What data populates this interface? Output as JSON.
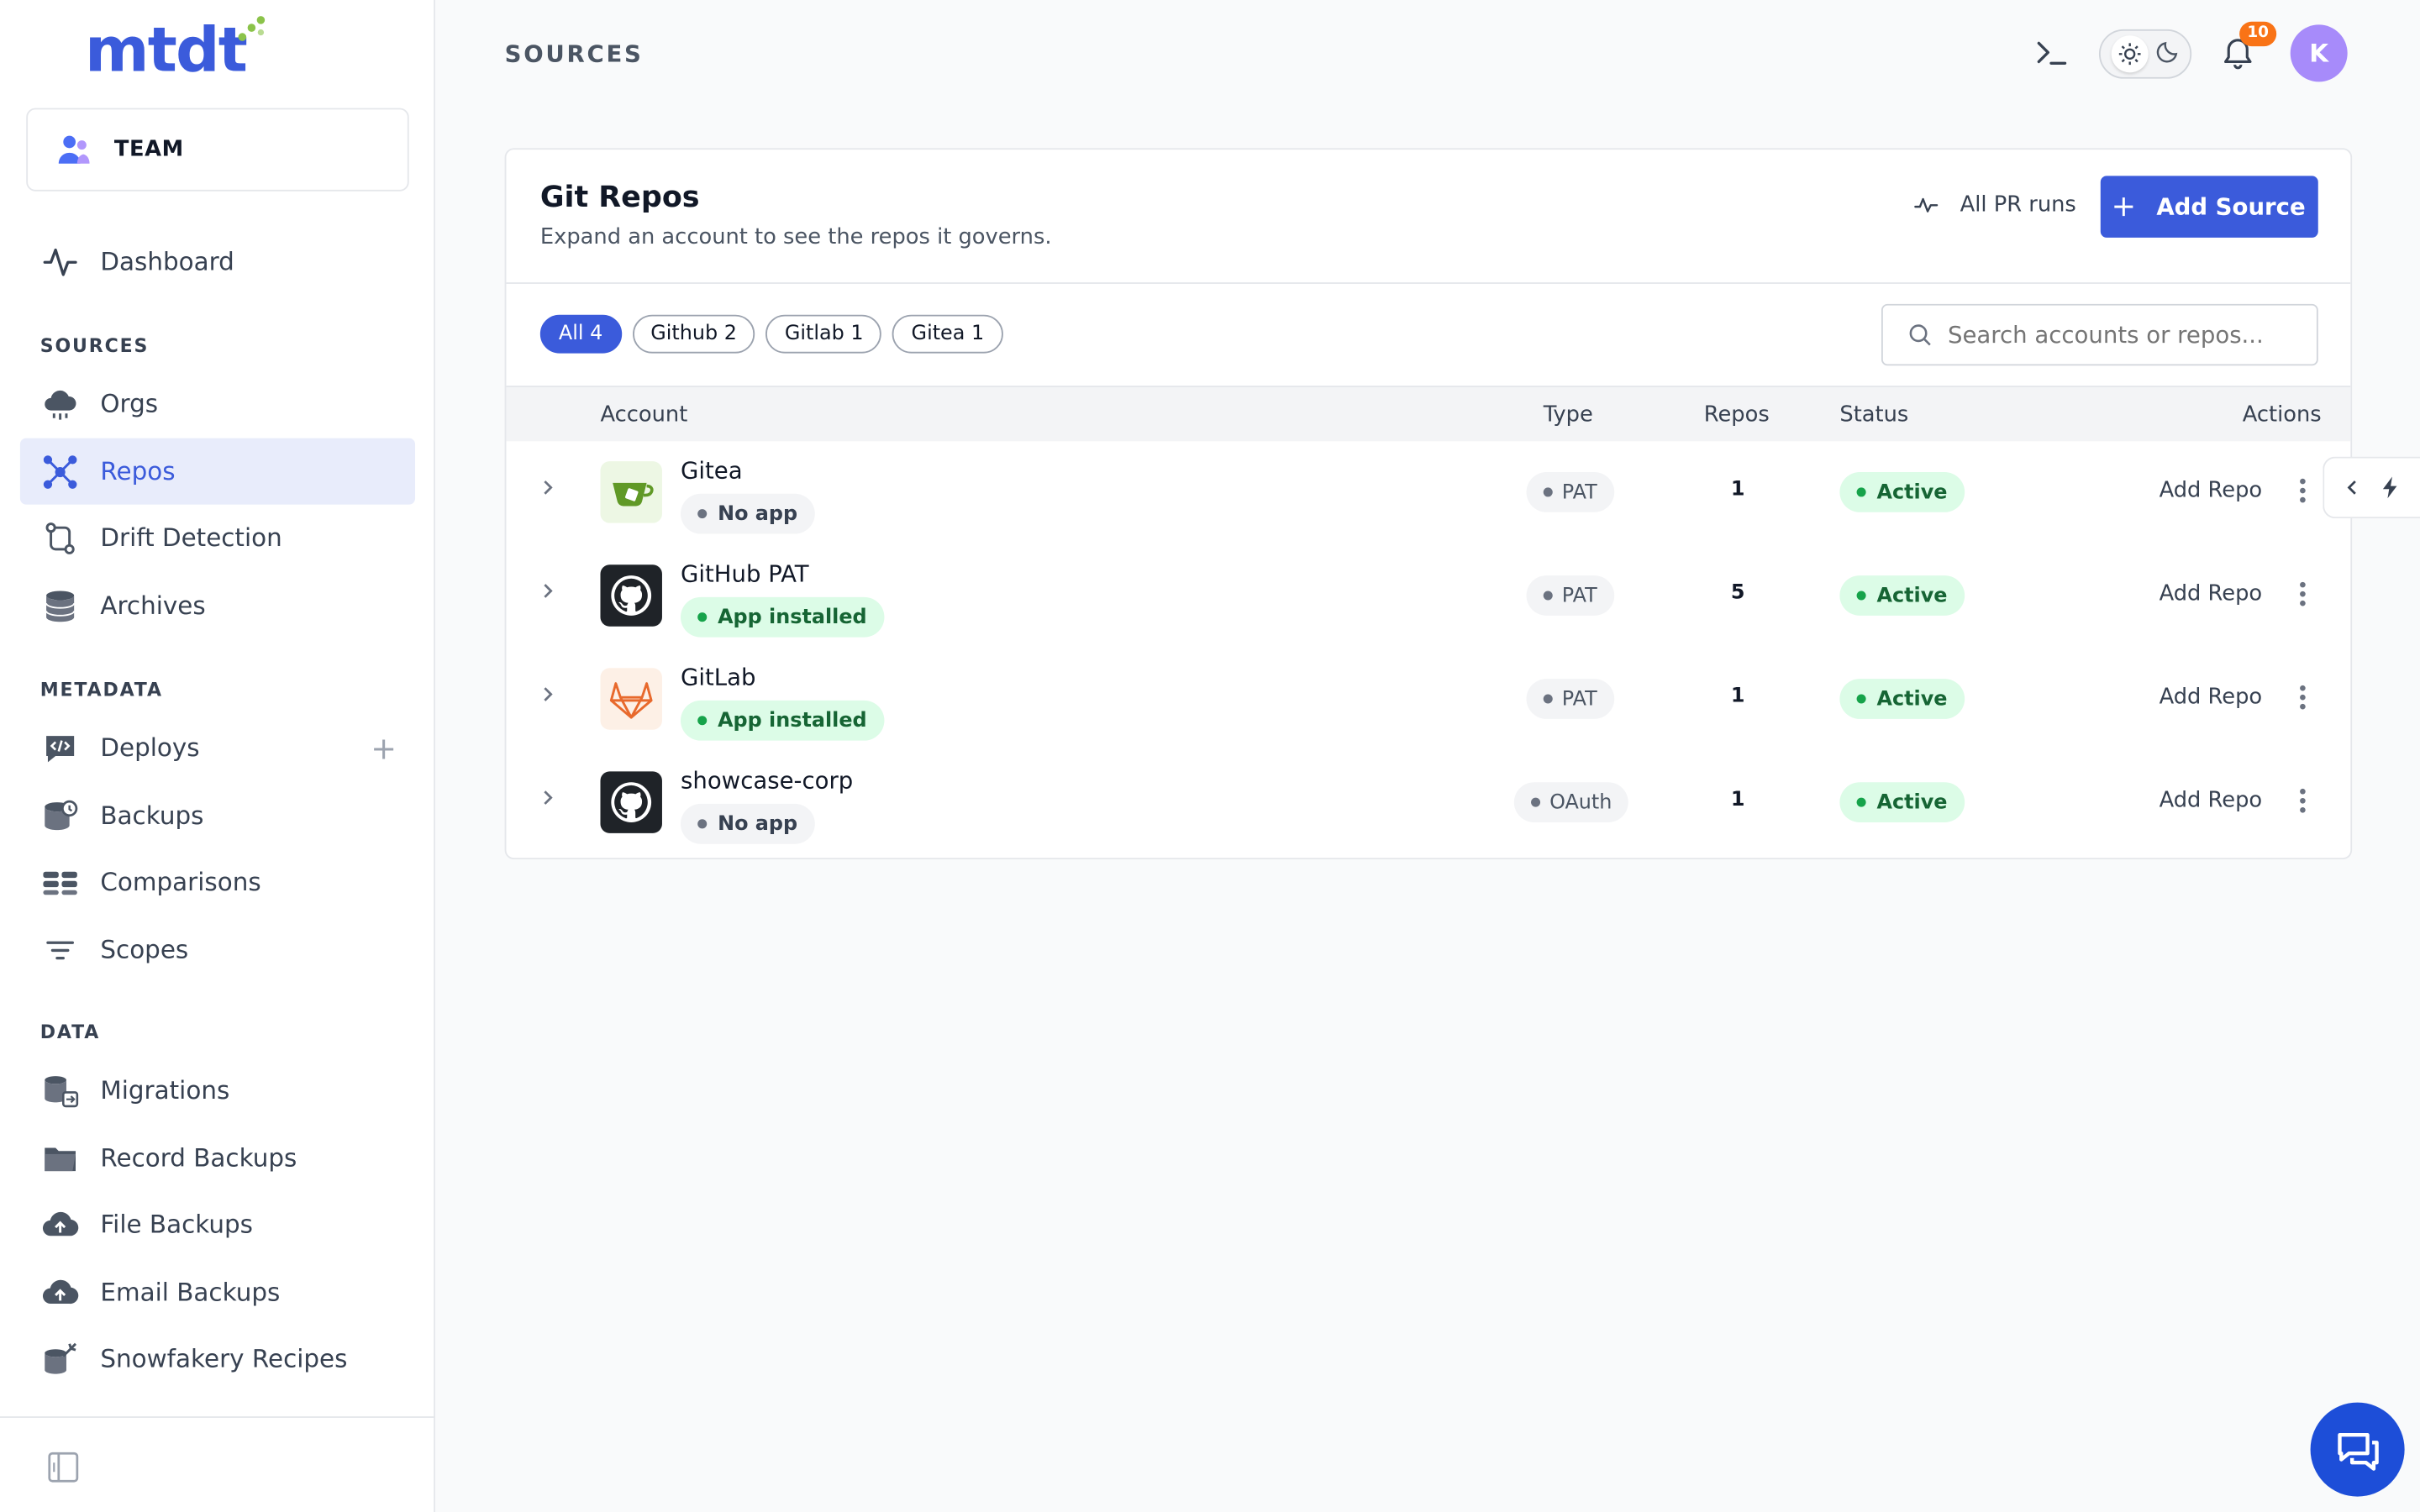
{
  "brand": {
    "logo_text": "mtdt",
    "accent": "#3b5bdb",
    "logo_dots_color": "#8bc34a"
  },
  "team": {
    "label": "TEAM"
  },
  "nav": {
    "top": [
      {
        "label": "Dashboard",
        "icon": "activity-icon"
      }
    ],
    "sections": [
      {
        "label": "SOURCES",
        "items": [
          {
            "label": "Orgs",
            "icon": "cloud-icon"
          },
          {
            "label": "Repos",
            "icon": "network-icon",
            "active": true
          },
          {
            "label": "Drift Detection",
            "icon": "git-compare-icon"
          },
          {
            "label": "Archives",
            "icon": "database-icon"
          }
        ]
      },
      {
        "label": "METADATA",
        "items": [
          {
            "label": "Deploys",
            "icon": "code-message-icon"
          },
          {
            "label": "Backups",
            "icon": "database-backup-icon"
          },
          {
            "label": "Comparisons",
            "icon": "compare-stack-icon"
          },
          {
            "label": "Scopes",
            "icon": "filter-icon"
          }
        ]
      },
      {
        "label": "DATA",
        "items": [
          {
            "label": "Migrations",
            "icon": "migration-icon"
          },
          {
            "label": "Record Backups",
            "icon": "folder-icon"
          },
          {
            "label": "File Backups",
            "icon": "cloud-upload-icon"
          },
          {
            "label": "Email Backups",
            "icon": "cloud-upload-icon"
          },
          {
            "label": "Snowfakery Recipes",
            "icon": "recipe-icon"
          }
        ]
      }
    ]
  },
  "header": {
    "title": "SOURCES",
    "notification_count": "10",
    "avatar_initial": "K"
  },
  "card": {
    "title": "Git Repos",
    "subtitle": "Expand an account to see the repos it governs.",
    "pr_runs_label": "All PR runs",
    "add_source_label": "Add Source",
    "search_placeholder": "Search accounts or repos...",
    "filters": [
      "All 4",
      "Github 2",
      "Gitlab 1",
      "Gitea 1"
    ],
    "columns": {
      "account": "Account",
      "type": "Type",
      "repos": "Repos",
      "status": "Status",
      "actions": "Actions"
    },
    "rows": [
      {
        "name": "Gitea",
        "app": "No app",
        "app_installed": false,
        "type": "PAT",
        "repos": "1",
        "status": "Active",
        "action": "Add Repo",
        "logo": "gitea-logo-icon"
      },
      {
        "name": "GitHub PAT",
        "app": "App installed",
        "app_installed": true,
        "type": "PAT",
        "repos": "5",
        "status": "Active",
        "action": "Add Repo",
        "logo": "github-logo-icon"
      },
      {
        "name": "GitLab",
        "app": "App installed",
        "app_installed": true,
        "type": "PAT",
        "repos": "1",
        "status": "Active",
        "action": "Add Repo",
        "logo": "gitlab-logo-icon"
      },
      {
        "name": "showcase-corp",
        "app": "No app",
        "app_installed": false,
        "type": "OAuth",
        "repos": "1",
        "status": "Active",
        "action": "Add Repo",
        "logo": "github-logo-icon"
      }
    ]
  }
}
